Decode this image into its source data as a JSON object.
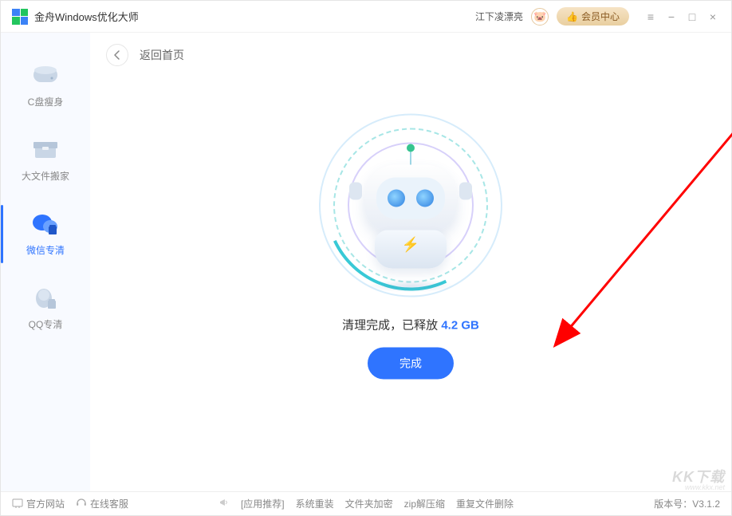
{
  "titlebar": {
    "app_name": "金舟Windows优化大师",
    "username": "江下凌漂亮",
    "avatar_emoji": "🐷",
    "vip_label": "会员中心"
  },
  "sidebar": {
    "items": [
      {
        "label": "C盘瘦身"
      },
      {
        "label": "大文件搬家"
      },
      {
        "label": "微信专清"
      },
      {
        "label": "QQ专清"
      }
    ]
  },
  "main": {
    "back_label": "返回首页",
    "result_prefix": "清理完成，已释放 ",
    "result_size": "4.2 GB",
    "done_button": "完成"
  },
  "footer": {
    "left": [
      {
        "label": "官方网站"
      },
      {
        "label": "在线客服"
      }
    ],
    "mid": [
      {
        "label": "[应用推荐]"
      },
      {
        "label": "系统重装"
      },
      {
        "label": "文件夹加密"
      },
      {
        "label": "zip解压缩"
      },
      {
        "label": "重复文件删除"
      }
    ],
    "version": "版本号：V3.1.2"
  },
  "watermark": {
    "main": "KK下载",
    "sub": "www.kkx.net"
  }
}
